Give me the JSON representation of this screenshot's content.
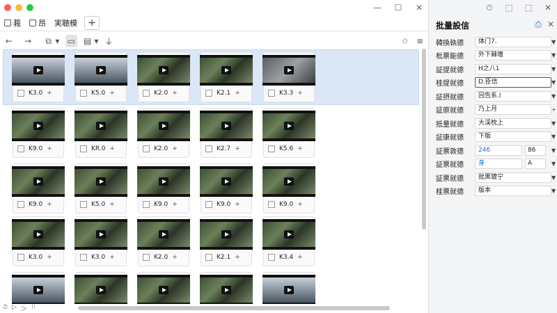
{
  "window": {
    "tabs": [
      {
        "label": "莪"
      },
      {
        "label": "昂"
      },
      {
        "label": "実聴模"
      }
    ],
    "add_tab": "+",
    "controls": {
      "minimize": "—",
      "maximize": "☐",
      "close": "✕"
    },
    "panel_controls": [
      "⏱",
      "⬚",
      "⬚",
      "✕"
    ]
  },
  "toolbar": {
    "back": "←",
    "forward": "→",
    "copy": "⧉",
    "view": "▭",
    "list": "▤",
    "chart": "⏚",
    "star": "☆",
    "menu": "≡"
  },
  "grid": {
    "selected_row": 0,
    "rows": [
      [
        {
          "code": "K3.0",
          "style": "sky"
        },
        {
          "code": "K5.0",
          "style": "sky"
        },
        {
          "code": "K2.0",
          "style": ""
        },
        {
          "code": "K2.1",
          "style": ""
        },
        {
          "code": "K3.3",
          "style": "grey"
        }
      ],
      [
        {
          "code": "K9.0",
          "style": ""
        },
        {
          "code": "KR.0",
          "style": ""
        },
        {
          "code": "K2.0",
          "style": ""
        },
        {
          "code": "K2.7",
          "style": ""
        },
        {
          "code": "K5.6",
          "style": ""
        }
      ],
      [
        {
          "code": "K9.0",
          "style": ""
        },
        {
          "code": "K5.0",
          "style": ""
        },
        {
          "code": "K9.0",
          "style": ""
        },
        {
          "code": "K9.0",
          "style": ""
        },
        {
          "code": "K9.0",
          "style": ""
        }
      ],
      [
        {
          "code": "K3.0",
          "style": ""
        },
        {
          "code": "K3.0",
          "style": ""
        },
        {
          "code": "K2.0",
          "style": ""
        },
        {
          "code": "K2.1",
          "style": ""
        },
        {
          "code": "K3.4",
          "style": ""
        }
      ],
      [
        {
          "code": "",
          "style": "sky"
        },
        {
          "code": "",
          "style": ""
        },
        {
          "code": "",
          "style": ""
        },
        {
          "code": "",
          "style": ""
        },
        {
          "code": "",
          "style": "sky"
        }
      ]
    ],
    "plus": "+"
  },
  "status": {
    "items": [
      "⏱",
      "▷",
      "＞",
      "⁝⁝"
    ]
  },
  "panel": {
    "title": "批量設信",
    "rows": [
      {
        "label": "韓換執德",
        "value": "体门7.",
        "type": "select"
      },
      {
        "label": "枇票能德",
        "value": "外下棘壇",
        "type": "select"
      },
      {
        "label": "証提就德",
        "value": "H之八1",
        "type": "select"
      },
      {
        "label": "桂提就德",
        "value": "D.臣信",
        "type": "select-focus"
      },
      {
        "label": "証摂就德",
        "value": "回告系.l",
        "type": "select"
      },
      {
        "label": "証原就德",
        "value": "乃上月",
        "type": "stepper"
      },
      {
        "label": "抵量就德",
        "value": "大渓枕上",
        "type": "select"
      },
      {
        "label": "証康就德",
        "value": "下版",
        "type": "select"
      },
      {
        "label": "証票敦德",
        "value": "246",
        "type": "unit",
        "unit": "86"
      },
      {
        "label": "証票就德",
        "value": "身",
        "type": "unit",
        "unit": "A"
      },
      {
        "label": "証票就德",
        "value": "批黑镀宁",
        "type": "select"
      },
      {
        "label": "桂票就德",
        "value": "版本",
        "type": "select"
      }
    ]
  }
}
